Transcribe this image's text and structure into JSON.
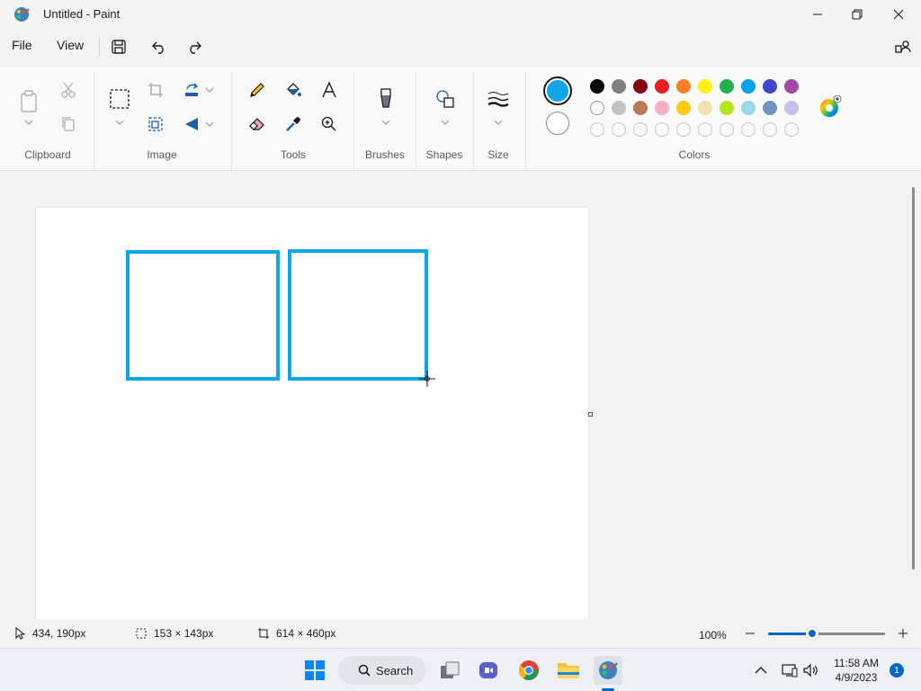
{
  "window": {
    "title": "Untitled - Paint",
    "app_icon": "paint-palette-icon",
    "controls": [
      "minimize-icon",
      "restore-icon",
      "close-icon"
    ]
  },
  "menu": {
    "file_label": "File",
    "view_label": "View",
    "icons": [
      "save-icon",
      "undo-icon",
      "redo-icon",
      "share-icon"
    ]
  },
  "ribbon": {
    "groups": {
      "clipboard": "Clipboard",
      "image": "Image",
      "tools": "Tools",
      "brushes": "Brushes",
      "shapes": "Shapes",
      "size": "Size",
      "colors": "Colors"
    },
    "primary_color": "#0ea5e9",
    "secondary_color": "#ffffff",
    "palette_row1": [
      "#000000",
      "#7f7f7f",
      "#880015",
      "#ed1c24",
      "#ff7f27",
      "#fff200",
      "#22b14c",
      "#00a2e8",
      "#3f48cc",
      "#a349a4"
    ],
    "palette_row2": [
      "#ffffff",
      "#c3c3c3",
      "#b97a57",
      "#ffaec9",
      "#ffc90e",
      "#efe4b0",
      "#b5e61d",
      "#99d9ea",
      "#7092be",
      "#c8bfe7"
    ],
    "palette_row3_empty_count": 10,
    "edit_colors_icon": "color-wheel-icon"
  },
  "canvas": {
    "shape_color": "#0ea5e9",
    "shapes": [
      "rectangle",
      "rectangle"
    ]
  },
  "status": {
    "cursor_position": "434, 190px",
    "selection_size": "153 × 143px",
    "canvas_size": "614 × 460px",
    "zoom_label": "100%",
    "zoom_level_fraction": 0.38
  },
  "taskbar": {
    "search_label": "Search",
    "time": "11:58 AM",
    "date": "4/9/2023",
    "notification_count": "1"
  }
}
